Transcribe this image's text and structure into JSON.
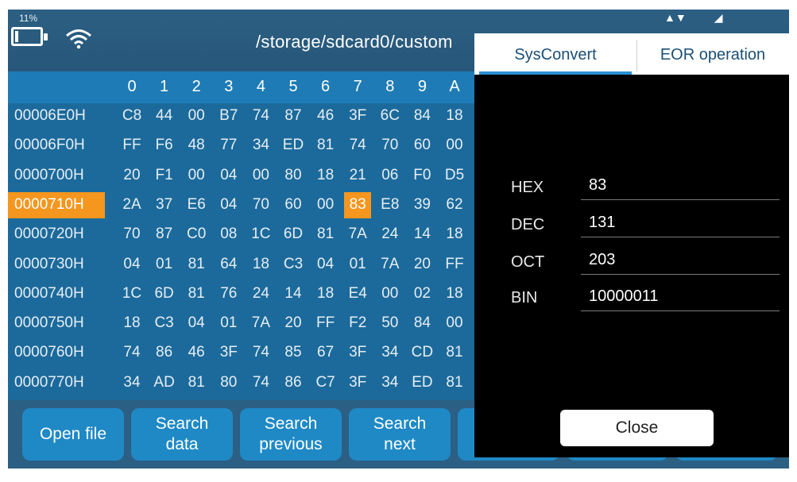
{
  "status": {
    "battery_pct": "11%",
    "path": "/storage/sdcard0/custom"
  },
  "table": {
    "columns": [
      "0",
      "1",
      "2",
      "3",
      "4",
      "5",
      "6",
      "7",
      "8",
      "9",
      "A"
    ],
    "rows": [
      {
        "addr": "00006E0H",
        "cells": [
          "C8",
          "44",
          "00",
          "B7",
          "74",
          "87",
          "46",
          "3F",
          "6C",
          "84",
          "18"
        ]
      },
      {
        "addr": "00006F0H",
        "cells": [
          "FF",
          "F6",
          "48",
          "77",
          "34",
          "ED",
          "81",
          "74",
          "70",
          "60",
          "00"
        ]
      },
      {
        "addr": "0000700H",
        "cells": [
          "20",
          "F1",
          "00",
          "04",
          "00",
          "80",
          "18",
          "21",
          "06",
          "F0",
          "D5"
        ]
      },
      {
        "addr": "0000710H",
        "cells": [
          "2A",
          "37",
          "E6",
          "04",
          "70",
          "60",
          "00",
          "83",
          "E8",
          "39",
          "62"
        ]
      },
      {
        "addr": "0000720H",
        "cells": [
          "70",
          "87",
          "C0",
          "08",
          "1C",
          "6D",
          "81",
          "7A",
          "24",
          "14",
          "18"
        ]
      },
      {
        "addr": "0000730H",
        "cells": [
          "04",
          "01",
          "81",
          "64",
          "18",
          "C3",
          "04",
          "01",
          "7A",
          "20",
          "FF"
        ]
      },
      {
        "addr": "0000740H",
        "cells": [
          "1C",
          "6D",
          "81",
          "76",
          "24",
          "14",
          "18",
          "E4",
          "00",
          "02",
          "18"
        ]
      },
      {
        "addr": "0000750H",
        "cells": [
          "18",
          "C3",
          "04",
          "01",
          "7A",
          "20",
          "FF",
          "F2",
          "50",
          "84",
          "00"
        ]
      },
      {
        "addr": "0000760H",
        "cells": [
          "74",
          "86",
          "46",
          "3F",
          "74",
          "85",
          "67",
          "3F",
          "34",
          "CD",
          "81"
        ]
      },
      {
        "addr": "0000770H",
        "cells": [
          "34",
          "AD",
          "81",
          "80",
          "74",
          "86",
          "C7",
          "3F",
          "34",
          "ED",
          "81"
        ]
      }
    ],
    "selected_row": 3,
    "selected_col": 7
  },
  "buttons": {
    "open_file": "Open file",
    "search_data_1": "Search",
    "search_data_2": "data",
    "search_prev_1": "Search",
    "search_prev_2": "previous",
    "search_next_1": "Search",
    "search_next_2": "next"
  },
  "dialog": {
    "tab_sysconvert": "SysConvert",
    "tab_eor": "EOR operation",
    "hex_label": "HEX",
    "hex_value": "83",
    "dec_label": "DEC",
    "dec_value": "131",
    "oct_label": "OCT",
    "oct_value": "203",
    "bin_label": "BIN",
    "bin_value": "10000011",
    "close": "Close"
  },
  "colors": {
    "accent_selected": "#f5961e",
    "table_bg": "#1c6a9b",
    "header_bg": "#1e7bb5",
    "button_bg": "#1f89c6"
  },
  "icons": {
    "battery": "battery-charging-icon",
    "wifi": "wifi-icon"
  }
}
